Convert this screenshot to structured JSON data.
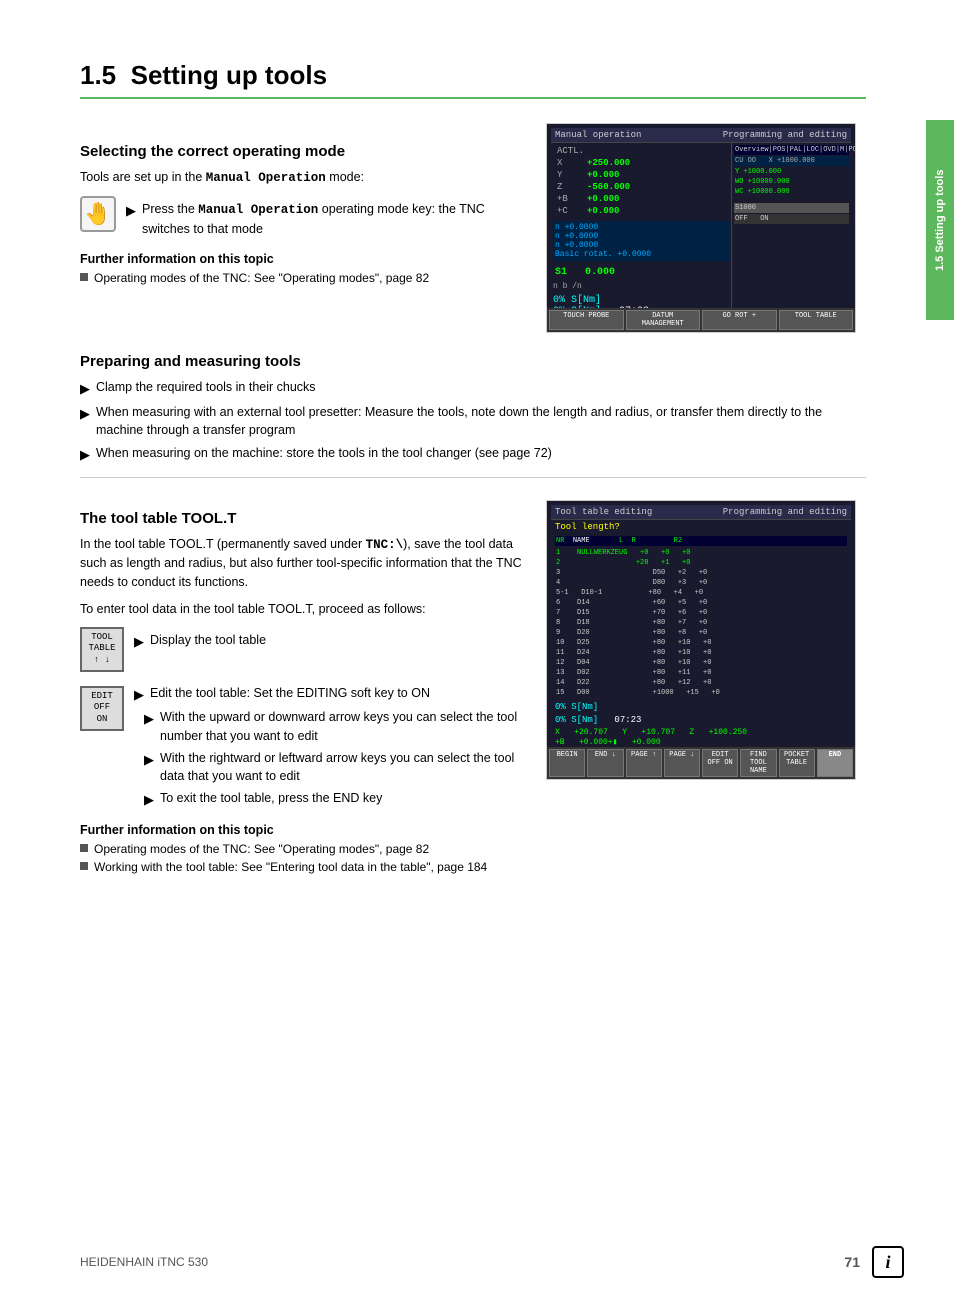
{
  "page": {
    "title": "1.5  Setting up tools",
    "title_num": "1.5",
    "title_text": "Setting up tools",
    "side_tab_text": "1.5 Setting up tools",
    "footer_brand": "HEIDENHAIN iTNC 530",
    "footer_page": "71"
  },
  "section1": {
    "heading": "Selecting the correct operating mode",
    "intro": "Tools are set up in the ",
    "intro_bold": "Manual Operation",
    "intro_rest": " mode:",
    "step1": "Press the ",
    "step1_bold": "Manual Operation",
    "step1_rest": " operating mode key: the TNC switches to that mode",
    "further_title": "Further information on this topic",
    "further_items": [
      "Operating modes of the TNC: See \"Operating modes\", page 82"
    ]
  },
  "section2": {
    "heading": "Preparing and measuring tools",
    "bullet1": "Clamp the required tools in their chucks",
    "bullet2": "When measuring with an external tool presetter: Measure the tools, note down the length and radius, or transfer them directly to the machine through a transfer program",
    "bullet3": "When measuring on the machine: store the tools in the tool changer (see page 72)"
  },
  "section3": {
    "heading": "The tool table TOOL.T",
    "intro1": "In the tool table TOOL.T (permanently saved under ",
    "intro1_bold": "TNC:\\",
    "intro1_rest": "), save the tool data such as length and radius, but also further tool-specific information that the TNC needs to conduct its functions.",
    "intro2": "To enter tool data in the tool table TOOL.T, proceed as follows:",
    "step_display": "Display the tool table",
    "step_edit_title": "Edit the tool table: Set the EDITING soft key to ON",
    "step_edit_bullets": [
      "With the upward or downward arrow keys you can select the tool number that you want to edit",
      "With the rightward or leftward arrow keys you can select the tool data that you want to edit",
      "To exit the tool table, press the END key"
    ],
    "further_title": "Further information on this topic",
    "further_items": [
      "Operating modes of the TNC: See \"Operating modes\", page 82",
      "Working with the tool table: See \"Entering tool data in the table\", page 184"
    ]
  },
  "screenshots": {
    "screen1_header_left": "Manual operation",
    "screen1_header_right": "Programming and editing",
    "screen2_header_left": "Tool table editing",
    "screen2_header_right": "Programming and editing",
    "screen2_sub": "Tool length?"
  },
  "icons": {
    "tool_icon_line1": "TOOL",
    "tool_icon_line2": "TABLE",
    "tool_icon_line3": "↑ ↓",
    "edit_icon_line1": "EDIT",
    "edit_icon_line2": "OFF  ON"
  }
}
